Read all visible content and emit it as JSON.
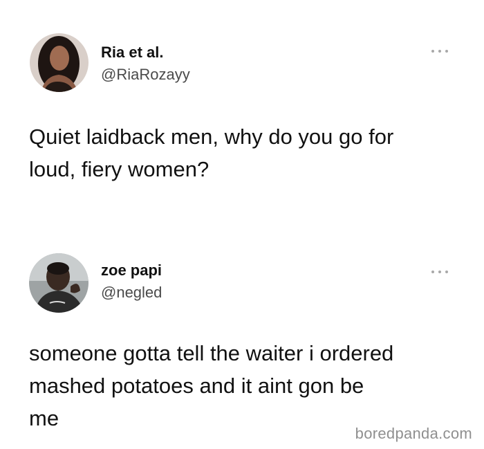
{
  "tweets": [
    {
      "display_name": "Ria et al.",
      "handle": "@RiaRozayy",
      "more_icon": "ellipsis-icon",
      "text_lines": [
        "Quiet laidback men, why do you go for",
        "loud, fiery women?"
      ]
    },
    {
      "display_name": "zoe papi",
      "handle": "@negled",
      "more_icon": "ellipsis-icon",
      "text_lines": [
        "someone gotta tell the waiter i ordered",
        "mashed potatoes and it aint gon be",
        "me"
      ]
    }
  ],
  "watermark": "boredpanda.com",
  "colors": {
    "background": "#ffffff",
    "text": "#111111",
    "handle": "#4a4a4a",
    "icon": "#a8a8a8",
    "watermark": "#8f8f8f"
  }
}
